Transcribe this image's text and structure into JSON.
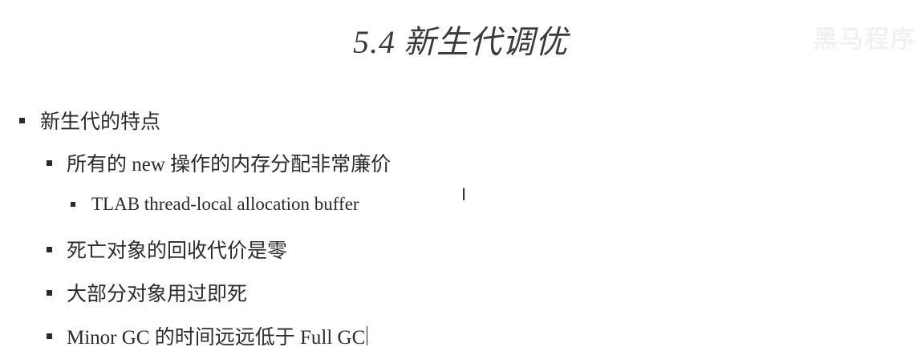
{
  "slide": {
    "title_number": "5.4",
    "title_text": "新生代调优",
    "watermark": "黑马程序"
  },
  "bullets": [
    {
      "level": 1,
      "text": "新生代的特点"
    },
    {
      "level": 2,
      "text": "所有的 new 操作的内存分配非常廉价"
    },
    {
      "level": 3,
      "text": "TLAB thread-local allocation buffer"
    },
    {
      "level": 2,
      "text": "死亡对象的回收代价是零"
    },
    {
      "level": 2,
      "text": "大部分对象用过即死"
    },
    {
      "level": 2,
      "text": "Minor GC 的时间远远低于 Full GC"
    }
  ],
  "cursor_glyph": "I"
}
